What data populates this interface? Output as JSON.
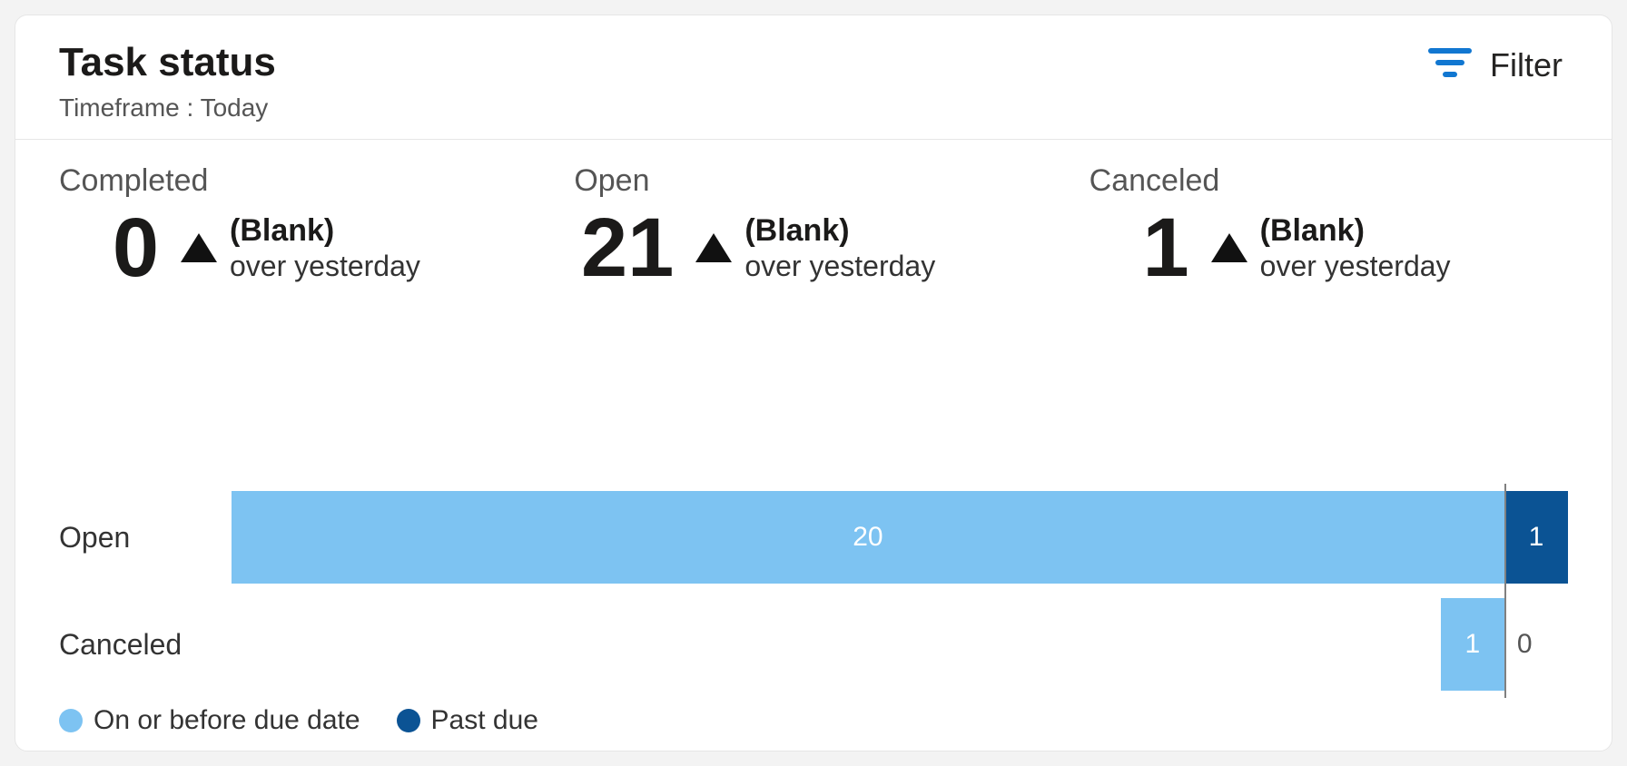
{
  "header": {
    "title": "Task status",
    "subtitle": "Timeframe : Today",
    "filter_label": "Filter"
  },
  "kpis": [
    {
      "label": "Completed",
      "value": "0",
      "delta_top": "(Blank)",
      "delta_bot": "over yesterday"
    },
    {
      "label": "Open",
      "value": "21",
      "delta_top": "(Blank)",
      "delta_bot": "over yesterday"
    },
    {
      "label": "Canceled",
      "value": "1",
      "delta_top": "(Blank)",
      "delta_bot": "over yesterday"
    }
  ],
  "legend": {
    "on_or_before": "On or before due date",
    "past_due": "Past due"
  },
  "colors": {
    "on_or_before": "#7dc3f2",
    "past_due": "#0b5394",
    "accent": "#1177d1"
  },
  "chart_data": {
    "type": "bar",
    "orientation": "horizontal",
    "stacked": true,
    "title": "Task status",
    "xlabel": "",
    "ylabel": "",
    "xlim": [
      0,
      21
    ],
    "categories": [
      "Open",
      "Canceled"
    ],
    "series": [
      {
        "name": "On or before due date",
        "values": [
          20,
          1
        ],
        "color": "#7dc3f2"
      },
      {
        "name": "Past due",
        "values": [
          1,
          0
        ],
        "color": "#0b5394"
      }
    ]
  }
}
